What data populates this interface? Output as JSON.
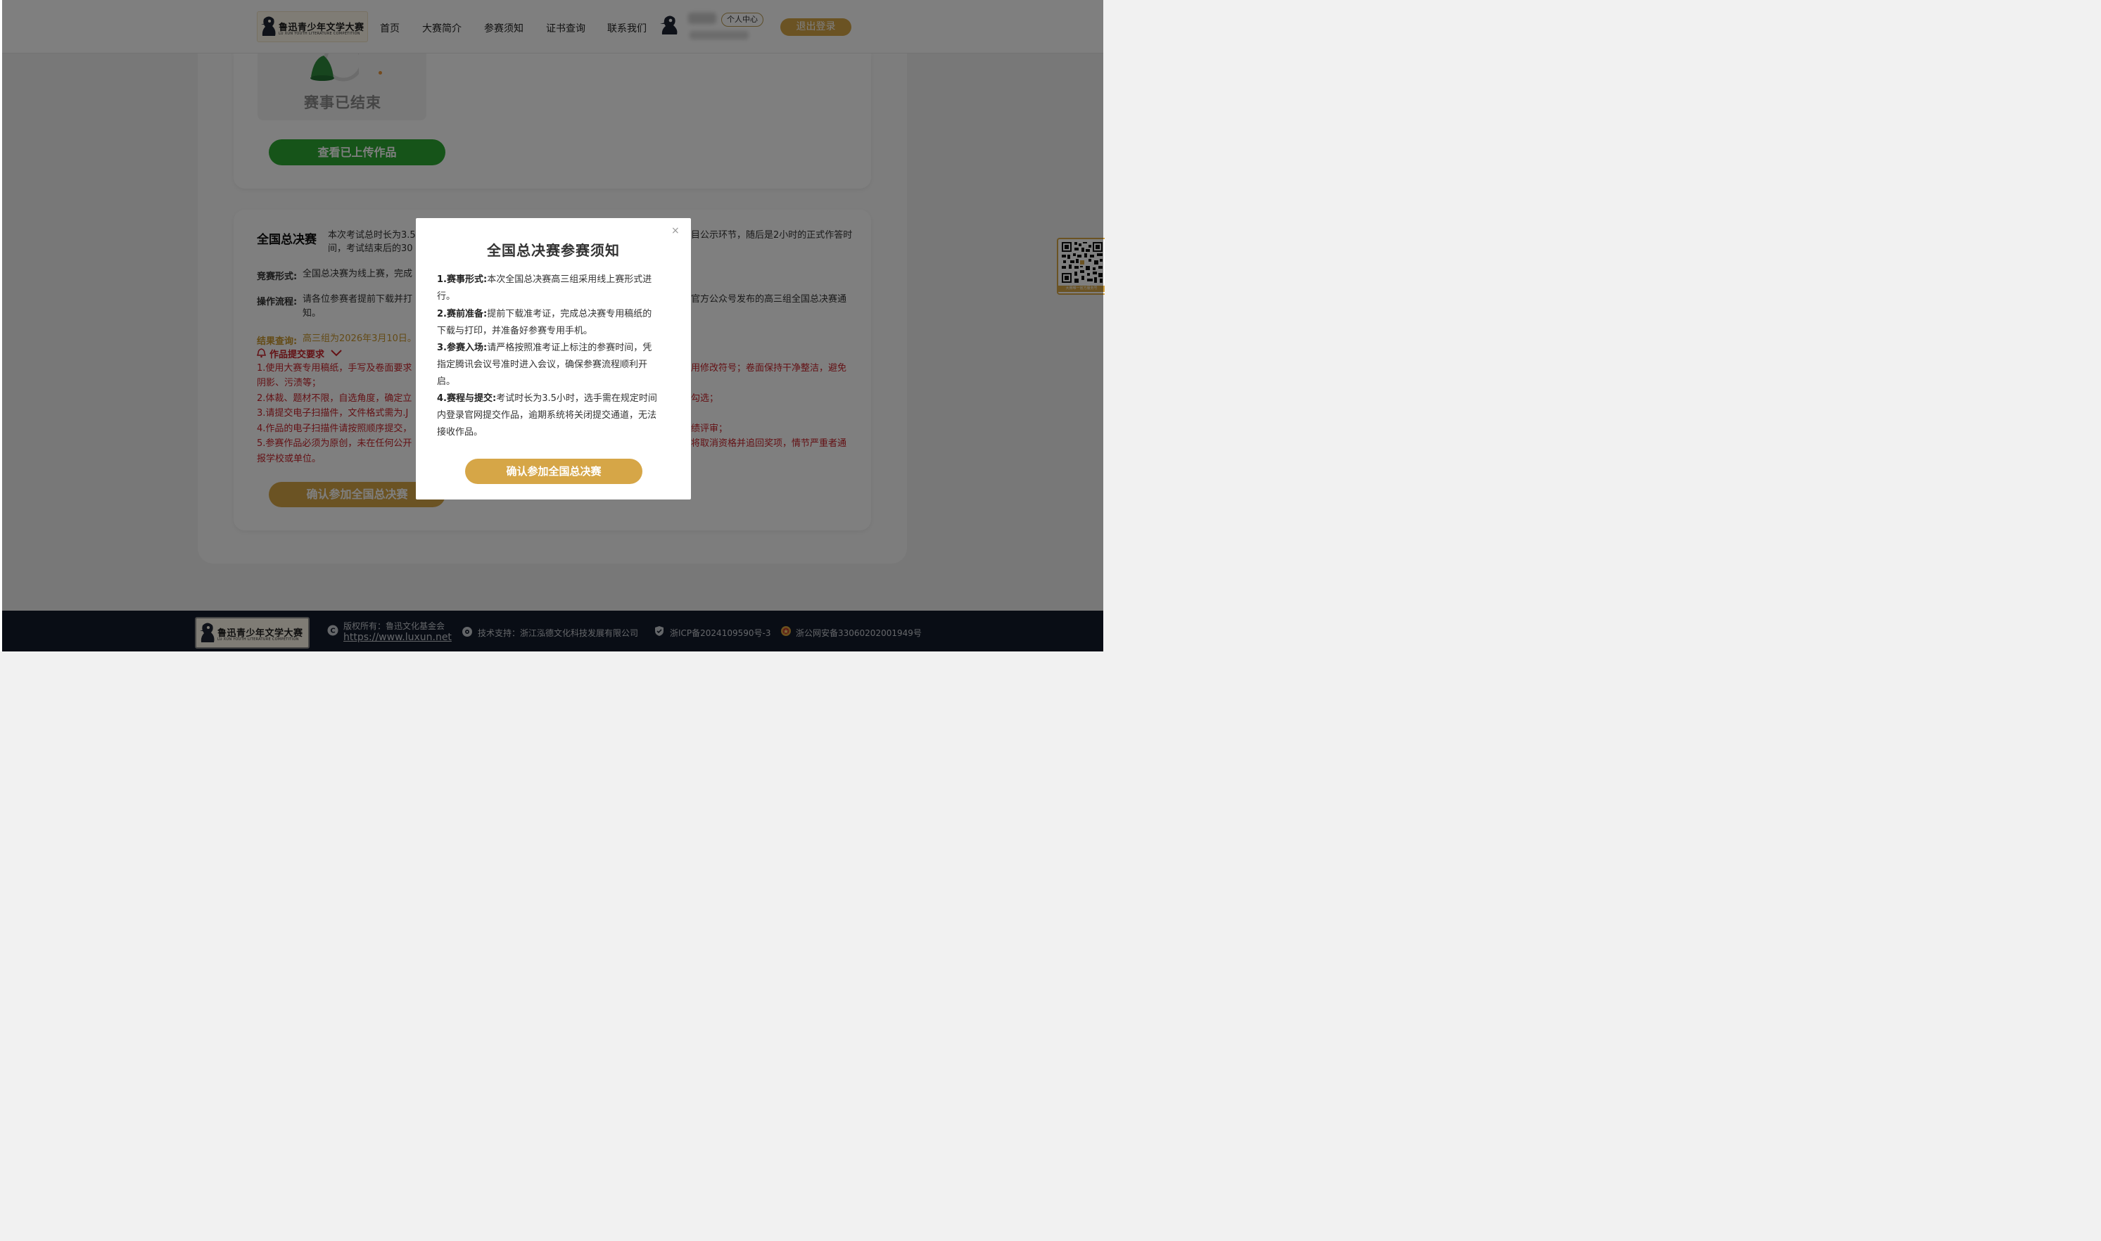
{
  "header": {
    "logo_text": "鲁迅青少年文学大赛",
    "logo_sub": "LU XUN YOUTH LITERATURE COMPETITION",
    "nav": [
      "首页",
      "大赛简介",
      "参赛须知",
      "证书查询",
      "联系我们"
    ],
    "personal_center": "个人中心",
    "logout": "退出登录"
  },
  "stage1": {
    "status": "赛事已结束",
    "view_button": "查看已上传作品"
  },
  "final": {
    "title": "全国总决赛",
    "intro_line1_left": "本次考试总时长为3.5",
    "intro_line1_right": "目公示环节，随后是2小时的正式作答时",
    "intro_line2": "间，考试结束后的30",
    "format_label": "竞赛形式:",
    "format_text": "全国总决赛为线上赛，完成",
    "process_label": "操作流程:",
    "process_line1_left": "请各位参赛者提前下载并打",
    "process_line1_right": "官方公众号发布的高三组全国总决赛通",
    "process_line2": "知。",
    "result_label": "结果查询:",
    "result_text": "高三组为2026年3月10日。",
    "req_title": "作品提交要求",
    "req_lines": [
      {
        "left": "1.使用大赛专用稿纸，手写及卷面要求",
        "right": "用修改符号；卷面保持干净整洁，避免"
      },
      {
        "left": "阴影、污渍等；",
        "right": ""
      },
      {
        "left": "2.体裁、题材不限，自选角度，确定立",
        "right": "勾选；"
      },
      {
        "left": "3.请提交电子扫描件，文件格式需为.J",
        "right": ""
      },
      {
        "left": "4.作品的电子扫描件请按照顺序提交，",
        "right": "绩评审；"
      },
      {
        "left": "5.参赛作品必须为原创，未在任何公开",
        "right": "将取消资格并追回奖项，情节严重者通"
      },
      {
        "left": "报学校或单位。",
        "right": ""
      }
    ],
    "confirm_button": "确认参加全国总决赛"
  },
  "qr": {
    "caption": "大赛唯一官方服务号"
  },
  "footer": {
    "copyright": "版权所有：鲁迅文化基金会",
    "url": "https://www.luxun.net",
    "tech": "技术支持：浙江泓德文化科技发展有限公司",
    "icp": "浙ICP备2024109590号-3",
    "police": "浙公网安备33060202001949号"
  },
  "modal": {
    "title": "全国总决赛参赛须知",
    "close": "×",
    "items": [
      {
        "label": "1.赛事形式:",
        "lines": [
          "本次全国总决赛高三组采用线上赛形式进",
          "行。"
        ]
      },
      {
        "label": "2.赛前准备:",
        "lines": [
          "提前下载准考证，完成总决赛专用稿纸的",
          "下载与打印，并准备好参赛专用手机。"
        ]
      },
      {
        "label": "3.参赛入场:",
        "lines": [
          "请严格按照准考证上标注的参赛时间，凭",
          "指定腾讯会议号准时进入会议，确保参赛流程顺利开",
          "启。"
        ]
      },
      {
        "label": "4.赛程与提交:",
        "lines": [
          "考试时长为3.5小时，选手需在规定时间",
          "内登录官网提交作品，逾期系统将关闭提交通道，无法",
          "接收作品。"
        ]
      }
    ],
    "confirm": "确认参加全国总决赛"
  }
}
